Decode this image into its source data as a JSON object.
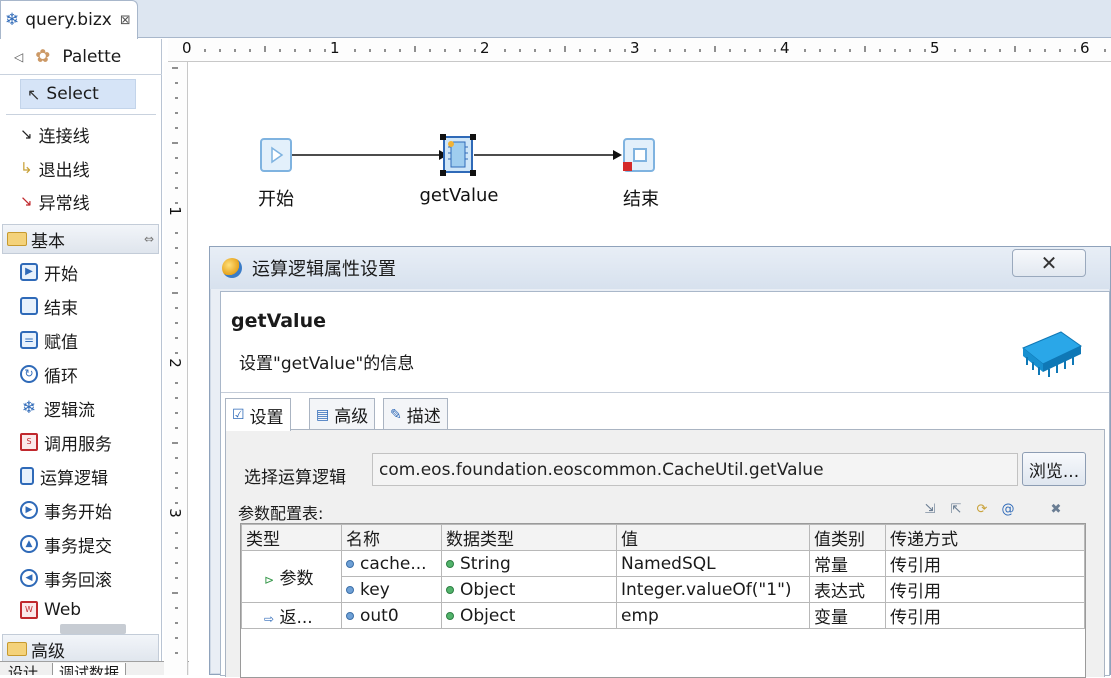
{
  "editor": {
    "tab_title": "query.bizx",
    "close_glyph": "⊠"
  },
  "palette": {
    "title": "Palette",
    "select_label": "Select",
    "tools": [
      {
        "label": "连接线",
        "icon": "connection-line-icon"
      },
      {
        "label": "退出线",
        "icon": "exit-line-icon"
      },
      {
        "label": "异常线",
        "icon": "exception-line-icon"
      }
    ],
    "drawer_basic": "基本",
    "basic_items": [
      {
        "label": "开始",
        "icon": "start-icon"
      },
      {
        "label": "结束",
        "icon": "end-icon"
      },
      {
        "label": "赋值",
        "icon": "assign-icon"
      },
      {
        "label": "循环",
        "icon": "loop-icon"
      },
      {
        "label": "逻辑流",
        "icon": "logic-flow-icon"
      },
      {
        "label": "调用服务",
        "icon": "invoke-service-icon"
      },
      {
        "label": "运算逻辑",
        "icon": "operation-logic-icon"
      },
      {
        "label": "事务开始",
        "icon": "transaction-begin-icon"
      },
      {
        "label": "事务提交",
        "icon": "transaction-commit-icon"
      },
      {
        "label": "事务回滚",
        "icon": "transaction-rollback-icon"
      },
      {
        "label": "Web",
        "icon": "web-icon"
      }
    ],
    "drawer_advanced": "高级"
  },
  "bottom_tabs": [
    "设计",
    "调试数据"
  ],
  "ruler": {
    "top_numbers": [
      "0",
      "1",
      "2",
      "3",
      "4",
      "5",
      "6"
    ],
    "left_numbers": [
      "1",
      "2",
      "3"
    ]
  },
  "diagram": {
    "nodes": [
      {
        "label": "开始"
      },
      {
        "label": "getValue"
      },
      {
        "label": "结束"
      }
    ]
  },
  "dialog": {
    "window_title": "运算逻辑属性设置",
    "heading": "getValue",
    "description": "设置\"getValue\"的信息",
    "tabs": [
      "设置",
      "高级",
      "描述"
    ],
    "select_logic_label": "选择运算逻辑",
    "select_logic_value": "com.eos.foundation.eoscommon.CacheUtil.getValue",
    "browse_label": "浏览...",
    "param_table_label": "参数配置表:",
    "columns": [
      "类型",
      "名称",
      "数据类型",
      "值",
      "值类别",
      "传递方式"
    ],
    "rows": [
      {
        "type": "参数",
        "name": "cache...",
        "datatype": "String",
        "value": "NamedSQL",
        "value_kind": "常量",
        "pass_mode": "传引用"
      },
      {
        "type": "",
        "name": "key",
        "datatype": "Object",
        "value": "Integer.valueOf(\"1\")",
        "value_kind": "表达式",
        "pass_mode": "传引用"
      },
      {
        "type": "返...",
        "name": "out0",
        "datatype": "Object",
        "value": "emp",
        "value_kind": "变量",
        "pass_mode": "传引用"
      }
    ]
  },
  "colors": {
    "accent": "#2f6ab8",
    "selection": "#d6e4f7",
    "folder": "#f4d27a"
  }
}
